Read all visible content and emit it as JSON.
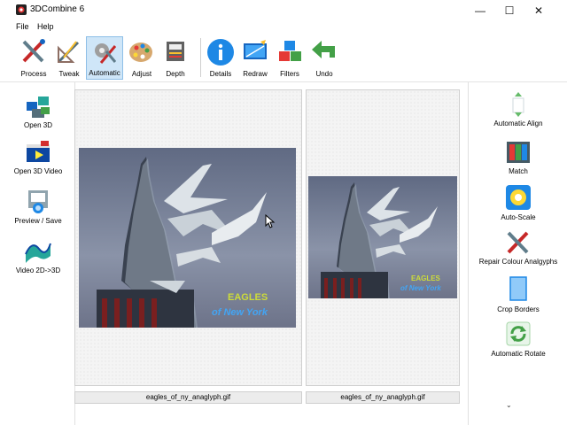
{
  "window": {
    "title": "3DCombine 6",
    "minimize_glyph": "—",
    "maximize_glyph": "☐",
    "close_glyph": "✕"
  },
  "menu": {
    "items": [
      "File",
      "Help"
    ]
  },
  "toolbar": {
    "buttons": [
      {
        "label": "Process",
        "icon": "process-icon"
      },
      {
        "label": "Tweak",
        "icon": "tweak-icon"
      },
      {
        "label": "Automatic",
        "icon": "automatic-icon",
        "active": true
      },
      {
        "label": "Adjust",
        "icon": "palette-icon"
      },
      {
        "label": "Depth",
        "icon": "depth-icon"
      },
      {
        "label": "Details",
        "icon": "info-icon"
      },
      {
        "label": "Redraw",
        "icon": "redraw-icon"
      },
      {
        "label": "Filters",
        "icon": "filters-icon"
      },
      {
        "label": "Undo",
        "icon": "undo-icon"
      }
    ]
  },
  "left_sidebar": {
    "items": [
      {
        "label": "Open 3D",
        "icon": "open-3d-icon"
      },
      {
        "label": "Open 3D Video",
        "icon": "open-3d-video-icon"
      },
      {
        "label": "Preview / Save",
        "icon": "preview-save-icon"
      },
      {
        "label": "Video 2D->3D",
        "icon": "video-2d-3d-icon"
      }
    ]
  },
  "right_sidebar": {
    "items": [
      {
        "label": "Automatic Align",
        "icon": "automatic-align-icon"
      },
      {
        "label": "Match",
        "icon": "match-icon"
      },
      {
        "label": "Auto-Scale",
        "icon": "auto-scale-icon"
      },
      {
        "label": "Repair Colour Analgyphs",
        "icon": "repair-colour-icon"
      },
      {
        "label": "Crop Borders",
        "icon": "crop-borders-icon"
      },
      {
        "label": "Automatic Rotate",
        "icon": "automatic-rotate-icon"
      }
    ],
    "more_glyph": "⌄"
  },
  "images": {
    "left": {
      "filename": "eagles_of_ny_anaglyph.gif",
      "caption_line1": "EAGLES",
      "caption_line2": "of New York"
    },
    "right": {
      "filename": "eagles_of_ny_anaglyph.gif",
      "caption_line1": "EAGLES",
      "caption_line2": "of New York"
    }
  },
  "colors": {
    "accent": "#1e88e5",
    "active_tool_bg": "#cfe6f8",
    "close_red": "#e81123"
  }
}
